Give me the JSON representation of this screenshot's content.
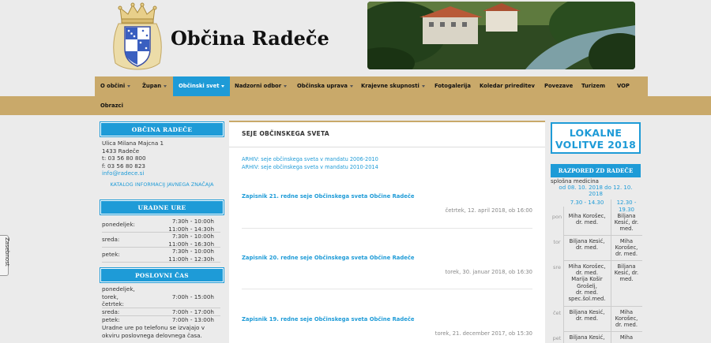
{
  "site": {
    "title": "Občina Radeče"
  },
  "nav": [
    {
      "label": "O občini",
      "caret": true
    },
    {
      "label": "Župan",
      "caret": true
    },
    {
      "label": "Občinski svet",
      "caret": true,
      "active": true
    },
    {
      "label": "Nadzorni odbor",
      "caret": true
    },
    {
      "label": "Občinska uprava",
      "caret": true
    },
    {
      "label": "Krajevne skupnosti",
      "caret": true
    },
    {
      "label": "Fotogalerija",
      "caret": false
    },
    {
      "label": "Koledar prireditev",
      "caret": false
    },
    {
      "label": "Povezave",
      "caret": false
    },
    {
      "label": "Turizem",
      "caret": false
    },
    {
      "label": "VOP",
      "caret": false
    },
    {
      "label": "Obrazci",
      "caret": false
    }
  ],
  "left": {
    "obcina_head": "OBČINA RADEČE",
    "address": [
      "Ulica Milana Majcna 1",
      "1433 Radeče",
      "t: 03 56 80 800",
      "f: 03 56 80 823"
    ],
    "email": "info@radece.si",
    "katalog": "KATALOG INFORMACIJ JAVNEGA ZNAČAJA",
    "uradne_head": "URADNE URE",
    "uradne": [
      {
        "day": "ponedeljek:",
        "times": [
          "7:30h - 10:00h",
          "11:00h - 14:30h"
        ]
      },
      {
        "day": "sreda:",
        "times": [
          "7:30h - 10:00h",
          "11:00h - 16:30h"
        ]
      },
      {
        "day": "petek:",
        "times": [
          "7:30h - 10:00h",
          "11:00h - 12:30h"
        ]
      }
    ],
    "poslovni_head": "POSLOVNI ČAS",
    "poslovni": [
      {
        "day": "ponedeljek,",
        "time": ""
      },
      {
        "day": "torek,",
        "time": "7:00h - 15:00h"
      },
      {
        "day": "četrtek:",
        "time": ""
      },
      {
        "day": "sreda:",
        "time": "7:00h - 17:00h"
      },
      {
        "day": "petek:",
        "time": "7:00h - 13:00h"
      }
    ],
    "poslovni_note": [
      "Uradne ure po telefonu se izvajajo v",
      "okviru poslovnega delovnega časa."
    ]
  },
  "main": {
    "title": "SEJE OBČINSKEGA SVETA",
    "archive": [
      "ARHIV: seje občinskega sveta v mandatu 2006-2010",
      "ARHIV: seje občinskega sveta v mandatu 2010-2014"
    ],
    "records": [
      {
        "title": "Zapisnik 21. redne seje Občinskega sveta Občine Radeče",
        "date": "četrtek, 12. april 2018, ob 16:00"
      },
      {
        "title": "Zapisnik 20. redne seje Občinskega sveta Občine Radeče",
        "date": "torek, 30. januar 2018, ob 16:30"
      },
      {
        "title": "Zapisnik 19. redne seje Občinskega sveta Občine Radeče",
        "date": "torek, 21. december 2017, ob 15:30"
      }
    ]
  },
  "right": {
    "volitve": [
      "LOKALNE",
      "VOLITVE 2018"
    ],
    "zd_head": "RAZPORED ZD RADEČE",
    "zd_sub": "splošna medicina",
    "zd_range": [
      "od 08. 10. 2018 do 12. 10.",
      "2018"
    ],
    "shift1": "7.30 - 14.30",
    "shift2": [
      "12.30 -",
      "19.30"
    ],
    "days": [
      {
        "day": "pon",
        "a": [
          "Miha Korošec,",
          "dr. med."
        ],
        "b": [
          "Biljana",
          "Kesić, dr.",
          "med."
        ]
      },
      {
        "day": "tor",
        "a": [
          "Biljana Kesić,",
          "dr. med."
        ],
        "b": [
          "Miha",
          "Korošec,",
          "dr. med."
        ]
      },
      {
        "day": "sre",
        "a": [
          "Miha Korošec,",
          "dr. med.",
          "Marija Košir",
          "Grošelj,",
          "dr. med.",
          "spec.šol.med."
        ],
        "b": [
          "Biljana",
          "Kesić, dr.",
          "med."
        ]
      },
      {
        "day": "čet",
        "a": [
          "Biljana Kesić,",
          "dr. med."
        ],
        "b": [
          "Miha",
          "Korošec,",
          "dr. med."
        ]
      },
      {
        "day": "pet",
        "a": [
          "Biljana Kesić,",
          ""
        ],
        "b": [
          "Miha",
          ""
        ]
      }
    ]
  },
  "sidetab": "Zasebnost",
  "colors": {
    "accent": "#1e9bd7",
    "gold": "#c9a96a"
  }
}
